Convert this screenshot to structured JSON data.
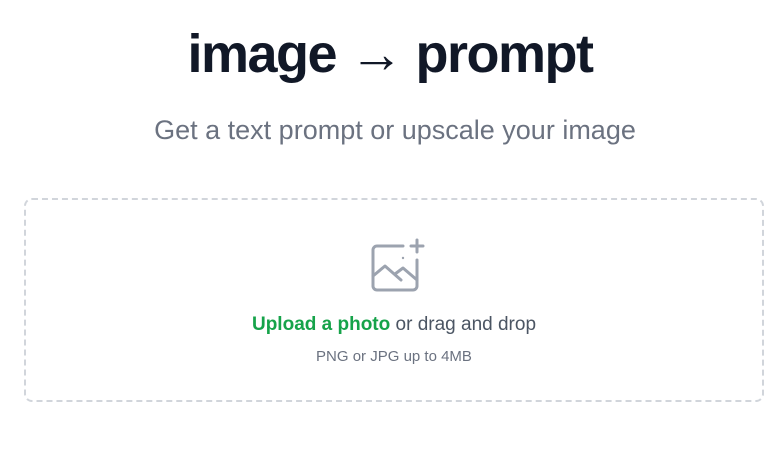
{
  "header": {
    "title": "image → prompt",
    "subtitle": "Get a text prompt or upscale your image"
  },
  "dropzone": {
    "icon": "image-add-icon",
    "upload_link": "Upload a photo",
    "upload_suffix": " or drag and drop",
    "hint": "PNG or JPG up to 4MB"
  },
  "colors": {
    "title": "#111827",
    "subtitle": "#6b7280",
    "link": "#16a34a",
    "border": "#d1d5db",
    "icon": "#9ca3af"
  }
}
